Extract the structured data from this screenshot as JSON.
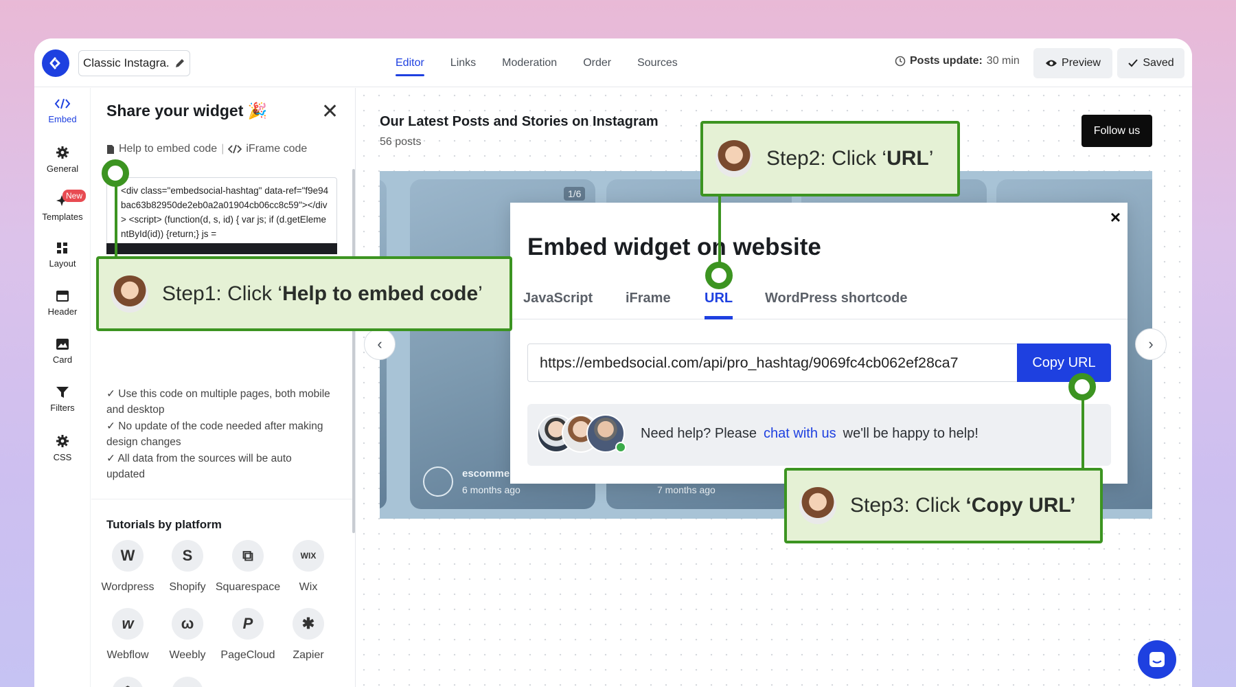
{
  "topbar": {
    "widget_name": "Classic Instagra...",
    "tabs": [
      "Editor",
      "Links",
      "Moderation",
      "Order",
      "Sources"
    ],
    "active_tab": "Editor",
    "posts_update_label": "Posts update:",
    "posts_update_value": "30 min",
    "preview_label": "Preview",
    "saved_label": "Saved"
  },
  "leftnav": {
    "items": [
      {
        "label": "Embed",
        "icon": "code-icon"
      },
      {
        "label": "General",
        "icon": "gear-icon"
      },
      {
        "label": "Templates",
        "icon": "sparkle-icon",
        "badge": "New"
      },
      {
        "label": "Layout",
        "icon": "layout-grid-icon"
      },
      {
        "label": "Header",
        "icon": "header-icon"
      },
      {
        "label": "Card",
        "icon": "image-icon"
      },
      {
        "label": "Filters",
        "icon": "filter-icon"
      },
      {
        "label": "CSS",
        "icon": "gear-icon"
      }
    ]
  },
  "panel": {
    "title": "Share your widget 🎉",
    "help_link": "Help to embed code",
    "separator": "|",
    "iframe_link": "iFrame code",
    "code": "<div class=\"embedsocial-hashtag\" data-ref=\"f9e94bac63b82950de2eb0a2a01904cb06cc8c59\"></div> <script> (function(d, s, id) { var js; if (d.getElementById(id)) {return;} js =",
    "checks": [
      "Use this code on multiple pages, both mobile and desktop",
      "No update of the code needed after making design changes",
      "All data from the sources will be auto updated"
    ],
    "tutorials_title": "Tutorials by platform",
    "platforms": [
      "Wordpress",
      "Shopify",
      "Squarespace",
      "Wix",
      "Webflow",
      "Weebly",
      "PageCloud",
      "Zapier"
    ]
  },
  "preview": {
    "title": "Our Latest Posts and Stories on Instagram",
    "count": "56 posts",
    "follow_label": "Follow us",
    "counter": "1/6",
    "card1_user": "escomme",
    "card1_time": "6 months ago",
    "card2_time": "7 months ago"
  },
  "modal": {
    "title": "Embed widget on website",
    "close": "×",
    "tabs": [
      "JavaScript",
      "iFrame",
      "URL",
      "WordPress shortcode"
    ],
    "active_tab": "URL",
    "url": "https://embedsocial.com/api/pro_hashtag/9069fc4cb062ef28ca7",
    "copy_label": "Copy URL",
    "help_pre": "Need help? Please",
    "help_link": "chat with us",
    "help_post": "we'll be happy to help!"
  },
  "callouts": {
    "step1_pre": "Step1: Click ‘",
    "step1_bold": "Help to embed code",
    "step1_post": "’",
    "step2_pre": "Step2: Click ‘",
    "step2_bold": "URL",
    "step2_post": "’",
    "step3_pre": "Step3: Click ",
    "step3_bold": "‘Copy URL’"
  },
  "colors": {
    "accent": "#1e40e0",
    "callout_border": "#3c9421",
    "callout_bg": "#e5f1d5"
  }
}
